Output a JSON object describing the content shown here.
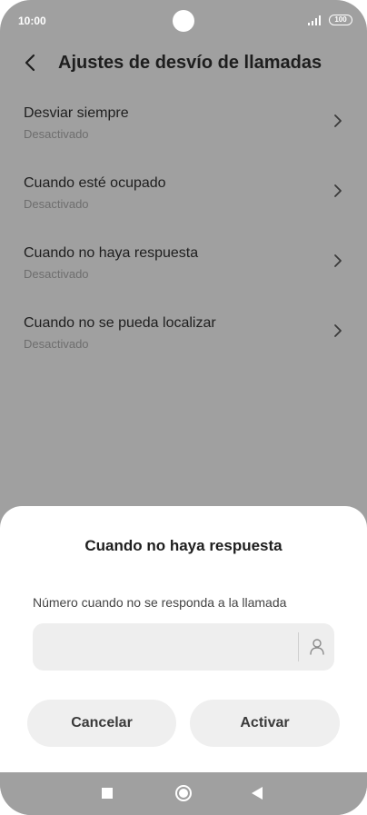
{
  "status_bar": {
    "time": "10:00",
    "battery": "100"
  },
  "header": {
    "title": "Ajustes de desvío de llamadas"
  },
  "settings": [
    {
      "title": "Desviar siempre",
      "subtitle": "Desactivado"
    },
    {
      "title": "Cuando esté ocupado",
      "subtitle": "Desactivado"
    },
    {
      "title": "Cuando no haya respuesta",
      "subtitle": "Desactivado"
    },
    {
      "title": "Cuando no se pueda localizar",
      "subtitle": "Desactivado"
    }
  ],
  "dialog": {
    "title": "Cuando no haya respuesta",
    "field_label": "Número cuando no se responda a la llamada",
    "field_value": "",
    "cancel_label": "Cancelar",
    "activate_label": "Activar"
  },
  "icons": {
    "back": "back-arrow-icon",
    "chevron": "chevron-right-icon",
    "contact": "contact-person-icon",
    "nav_recent": "square-icon",
    "nav_home": "circle-icon",
    "nav_back": "triangle-icon"
  },
  "colors": {
    "overlay_background": "#a0a0a0",
    "sheet_background": "#ffffff",
    "button_background": "#efefef"
  }
}
